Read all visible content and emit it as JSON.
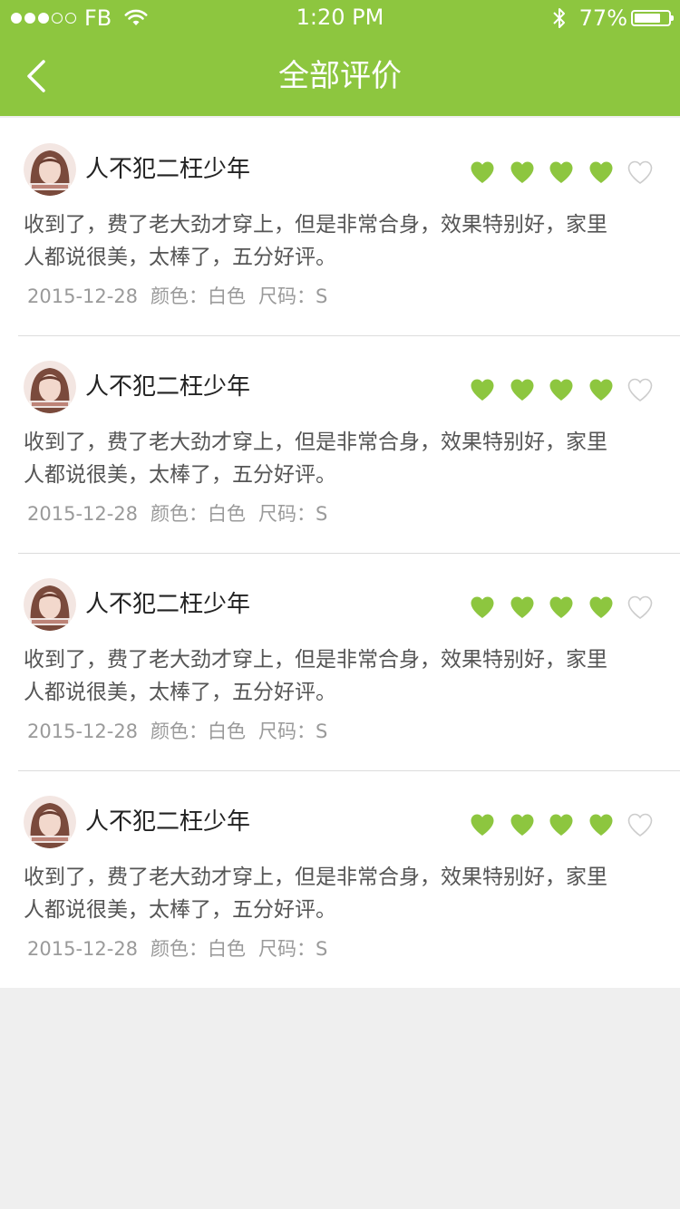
{
  "status_bar": {
    "carrier": "FB",
    "time": "1:20 PM",
    "battery": "77%",
    "battery_level": 0.77
  },
  "nav": {
    "back_icon": "chevron-left-icon",
    "title": "全部评价"
  },
  "colors": {
    "brand_green": "#8dc63f",
    "heart_filled": "#8dc63f",
    "heart_empty": "#cccccc"
  },
  "reviews": [
    {
      "username": "人不犯二枉少年",
      "rating": 4,
      "rating_max": 5,
      "content": "收到了，费了老大劲才穿上，但是非常合身，效果特别好，家里人都说很美，太棒了，五分好评。",
      "date": "2015-12-28",
      "color": "颜色：白色",
      "size": "尺码：S"
    },
    {
      "username": "人不犯二枉少年",
      "rating": 4,
      "rating_max": 5,
      "content": "收到了，费了老大劲才穿上，但是非常合身，效果特别好，家里人都说很美，太棒了，五分好评。",
      "date": "2015-12-28",
      "color": "颜色：白色",
      "size": "尺码：S"
    },
    {
      "username": "人不犯二枉少年",
      "rating": 4,
      "rating_max": 5,
      "content": "收到了，费了老大劲才穿上，但是非常合身，效果特别好，家里人都说很美，太棒了，五分好评。",
      "date": "2015-12-28",
      "color": "颜色：白色",
      "size": "尺码：S"
    },
    {
      "username": "人不犯二枉少年",
      "rating": 4,
      "rating_max": 5,
      "content": "收到了，费了老大劲才穿上，但是非常合身，效果特别好，家里人都说很美，太棒了，五分好评。",
      "date": "2015-12-28",
      "color": "颜色：白色",
      "size": "尺码：S"
    }
  ]
}
